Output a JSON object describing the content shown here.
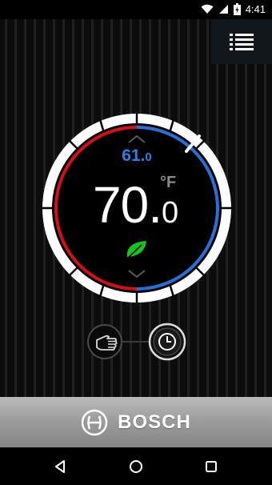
{
  "status_bar": {
    "time": "4:41",
    "icons": [
      "wifi-icon",
      "signal-icon",
      "battery-icon"
    ]
  },
  "header": {
    "menu_icon": "menu-icon"
  },
  "thermostat": {
    "setpoint_int": "61.",
    "setpoint_dec": "0",
    "current_int": "70.",
    "current_dec": "0",
    "unit": "°F",
    "eco_icon": "leaf-icon",
    "up_icon": "chevron-up-icon",
    "down_icon": "chevron-down-icon",
    "colors": {
      "heat": "#d0111b",
      "cool": "#2b6fd6",
      "eco": "#19c21e",
      "ring": "#ffffff"
    }
  },
  "modes": {
    "manual_icon": "hand-icon",
    "schedule_icon": "clock-icon",
    "active": "schedule"
  },
  "footer": {
    "brand": "BOSCH",
    "logo_icon": "bosch-logo-icon"
  },
  "nav": {
    "back_icon": "back-icon",
    "home_icon": "home-icon",
    "recents_icon": "recents-icon"
  }
}
